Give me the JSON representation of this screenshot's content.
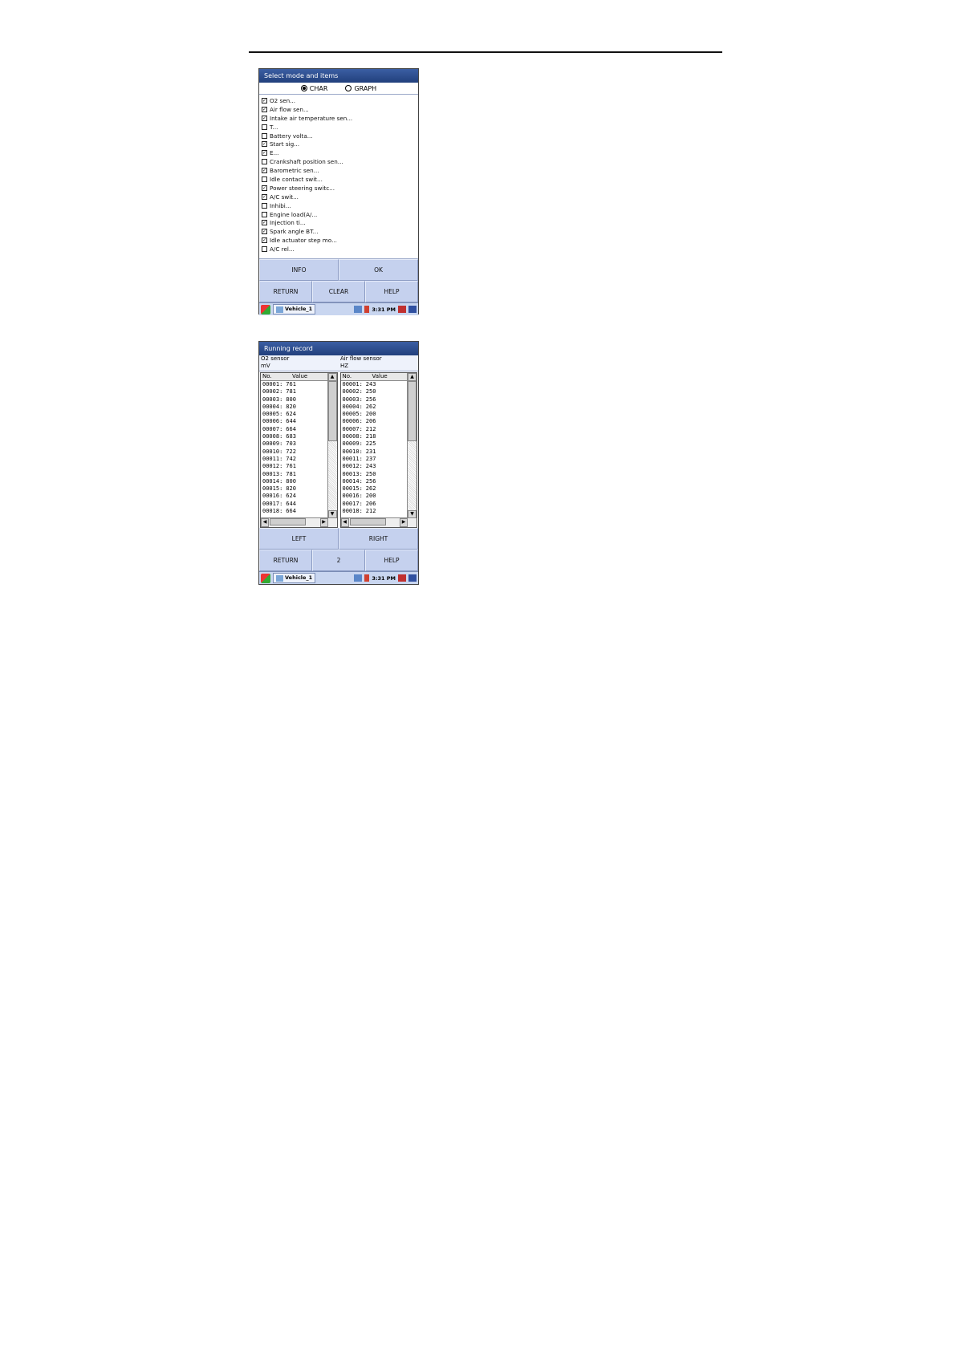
{
  "screen1": {
    "title": "Select mode and items",
    "modes": [
      {
        "label": "CHAR",
        "selected": true
      },
      {
        "label": "GRAPH",
        "selected": false
      }
    ],
    "items": [
      {
        "label": "O2 sen...",
        "checked": true
      },
      {
        "label": "Air flow sen...",
        "checked": true
      },
      {
        "label": "Intake air temperature sen...",
        "checked": true
      },
      {
        "label": "T...",
        "checked": false
      },
      {
        "label": "Battery volta...",
        "checked": false
      },
      {
        "label": "Start sig...",
        "checked": true
      },
      {
        "label": "E...",
        "checked": true
      },
      {
        "label": "Crankshaft position sen...",
        "checked": false
      },
      {
        "label": "Barometric sen...",
        "checked": true
      },
      {
        "label": "Idle contact swit...",
        "checked": false
      },
      {
        "label": "Power steering switc...",
        "checked": true
      },
      {
        "label": "A/C swit...",
        "checked": true
      },
      {
        "label": "Inhibi...",
        "checked": false
      },
      {
        "label": "Engine load(A/...",
        "checked": false
      },
      {
        "label": "Injection ti...",
        "checked": true
      },
      {
        "label": "Spark angle BT...",
        "checked": true
      },
      {
        "label": "Idle actuator step mo...",
        "checked": true
      },
      {
        "label": "A/C rel...",
        "checked": false
      }
    ],
    "buttons": {
      "info": "INFO",
      "ok": "OK",
      "return": "RETURN",
      "clear": "CLEAR",
      "help": "HELP"
    }
  },
  "screen2": {
    "title": "Running record",
    "left": {
      "name": "O2 sensor",
      "unit": "mV"
    },
    "right": {
      "name": "Air flow sensor",
      "unit": "HZ"
    },
    "col_no": "No.",
    "col_value": "Value",
    "left_rows": [
      [
        "00001:",
        "761"
      ],
      [
        "00002:",
        "781"
      ],
      [
        "00003:",
        "800"
      ],
      [
        "00004:",
        "820"
      ],
      [
        "00005:",
        "624"
      ],
      [
        "00006:",
        "644"
      ],
      [
        "00007:",
        "664"
      ],
      [
        "00008:",
        "683"
      ],
      [
        "00009:",
        "703"
      ],
      [
        "00010:",
        "722"
      ],
      [
        "00011:",
        "742"
      ],
      [
        "00012:",
        "761"
      ],
      [
        "00013:",
        "781"
      ],
      [
        "00014:",
        "800"
      ],
      [
        "00015:",
        "820"
      ],
      [
        "00016:",
        "624"
      ],
      [
        "00017:",
        "644"
      ],
      [
        "00018:",
        "664"
      ]
    ],
    "right_rows": [
      [
        "00001:",
        "243"
      ],
      [
        "00002:",
        "250"
      ],
      [
        "00003:",
        "256"
      ],
      [
        "00004:",
        "262"
      ],
      [
        "00005:",
        "200"
      ],
      [
        "00006:",
        "206"
      ],
      [
        "00007:",
        "212"
      ],
      [
        "00008:",
        "218"
      ],
      [
        "00009:",
        "225"
      ],
      [
        "00010:",
        "231"
      ],
      [
        "00011:",
        "237"
      ],
      [
        "00012:",
        "243"
      ],
      [
        "00013:",
        "250"
      ],
      [
        "00014:",
        "256"
      ],
      [
        "00015:",
        "262"
      ],
      [
        "00016:",
        "200"
      ],
      [
        "00017:",
        "206"
      ],
      [
        "00018:",
        "212"
      ]
    ],
    "buttons": {
      "left": "LEFT",
      "right": "RIGHT",
      "return": "RETURN",
      "page": "2",
      "help": "HELP"
    }
  },
  "taskbar": {
    "app": "Vehicle_1",
    "time": "3:31 PM"
  },
  "colors": {
    "title_bar": "#2b4a8a",
    "button_face": "#c5d1ee",
    "taskbar": "#c9d6f0"
  },
  "icons": [
    "windows-start-icon",
    "vehicle-app-icon",
    "network-icon",
    "signal-icon",
    "tray-icon",
    "keyboard-icon"
  ]
}
